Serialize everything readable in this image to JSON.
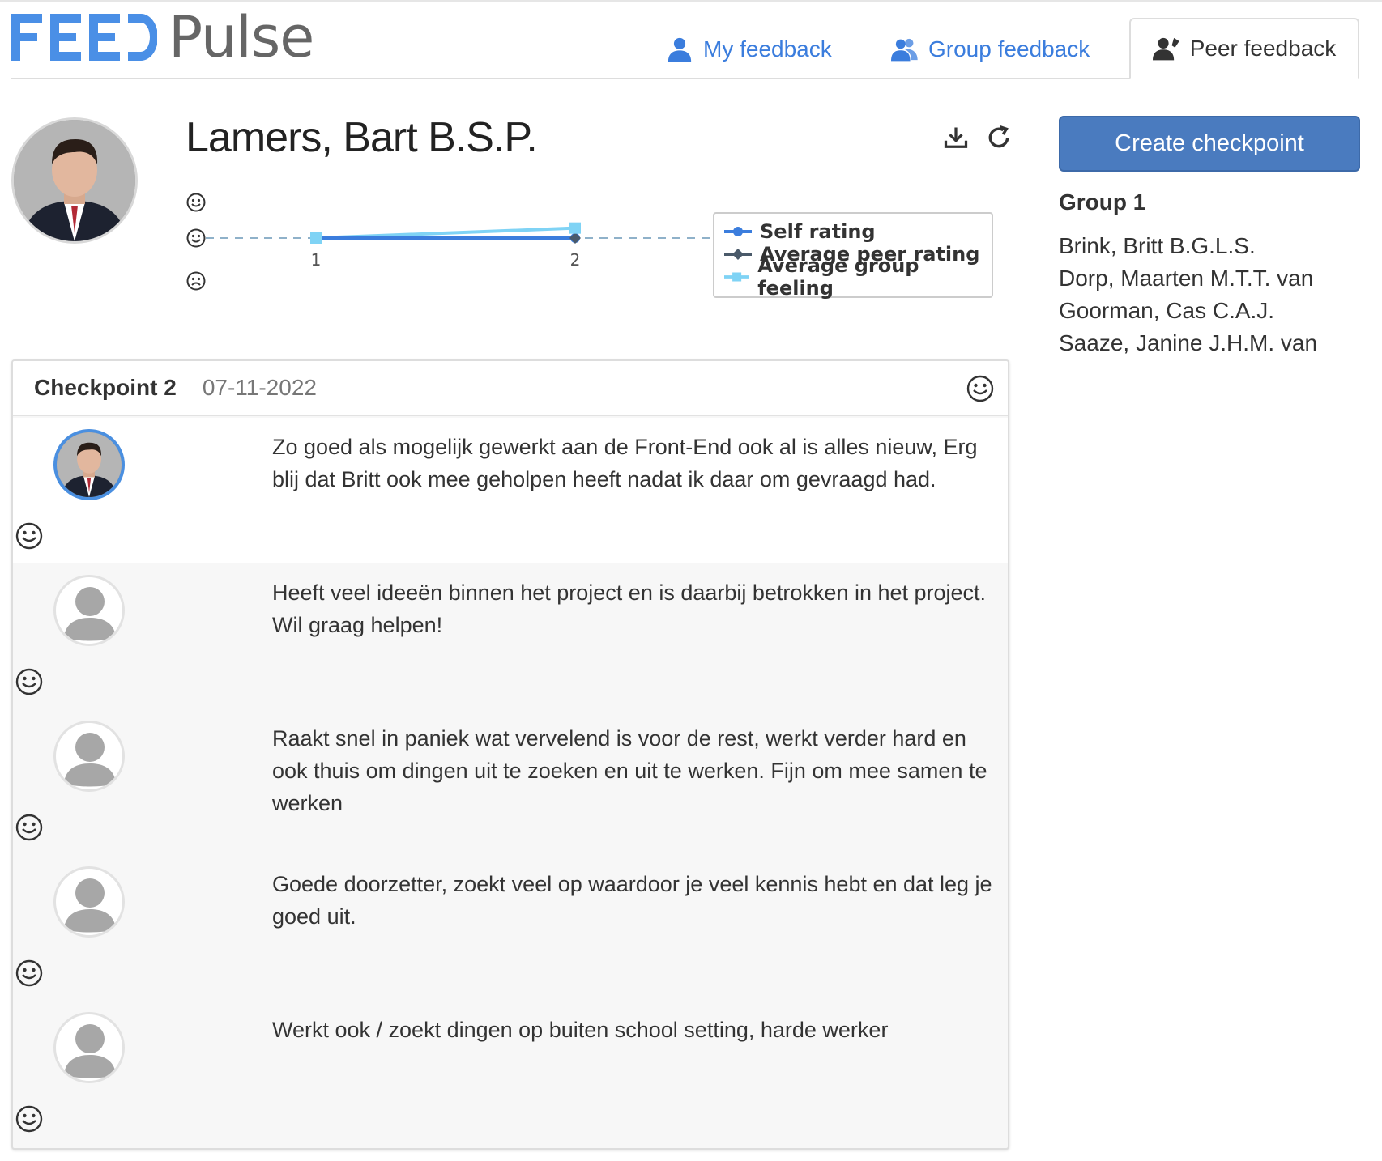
{
  "header": {
    "logo_feed": "FEED",
    "logo_pulse": "Pulse",
    "tabs": [
      {
        "label": "My feedback"
      },
      {
        "label": "Group feedback"
      },
      {
        "label": "Peer feedback"
      }
    ]
  },
  "profile": {
    "name": "Lamers, Bart B.S.P."
  },
  "chart_data": {
    "type": "line",
    "x": [
      1,
      2
    ],
    "x_tick_labels": [
      "1",
      "2"
    ],
    "y_levels": [
      "happy",
      "neutral",
      "sad"
    ],
    "series": [
      {
        "name": "Self rating",
        "color": "#3b7ddd",
        "values": [
          0,
          0
        ]
      },
      {
        "name": "Average peer rating",
        "color": "#4a5a6a",
        "values": [
          0,
          0
        ]
      },
      {
        "name": "Average group feeling",
        "color": "#7fd3f5",
        "values": [
          0,
          0.28
        ]
      }
    ],
    "legend_position": "right"
  },
  "sidebar": {
    "create_button": "Create checkpoint",
    "group_title": "Group 1",
    "members": [
      "Brink, Britt B.G.L.S.",
      "Dorp, Maarten M.T.T. van",
      "Goorman, Cas C.A.J.",
      "Saaze, Janine J.H.M. van"
    ]
  },
  "checkpoint": {
    "title": "Checkpoint 2",
    "date": "07-11-2022",
    "entries": [
      {
        "type": "self",
        "text": "Zo goed als mogelijk gewerkt aan de Front-End ook al is alles nieuw, Erg blij dat Britt ook mee geholpen heeft nadat ik daar om gevraagd had."
      },
      {
        "type": "peer",
        "text": "Heeft veel ideeën binnen het project en is daarbij betrokken in het project. Wil graag helpen!"
      },
      {
        "type": "peer",
        "text": "Raakt snel in paniek wat vervelend is voor de rest, werkt verder hard en ook thuis om dingen uit te zoeken en uit te werken. Fijn om mee samen te werken"
      },
      {
        "type": "peer",
        "text": "Goede doorzetter, zoekt veel op waardoor je veel kennis hebt en dat leg je goed uit."
      },
      {
        "type": "peer",
        "text": "Werkt ook / zoekt dingen op buiten school setting, harde werker"
      }
    ]
  },
  "colors": {
    "accent": "#3b7ddd",
    "button": "#4a7bbf",
    "self_line": "#3b7ddd",
    "peer_line": "#4a5a6a",
    "group_line": "#7fd3f5"
  }
}
